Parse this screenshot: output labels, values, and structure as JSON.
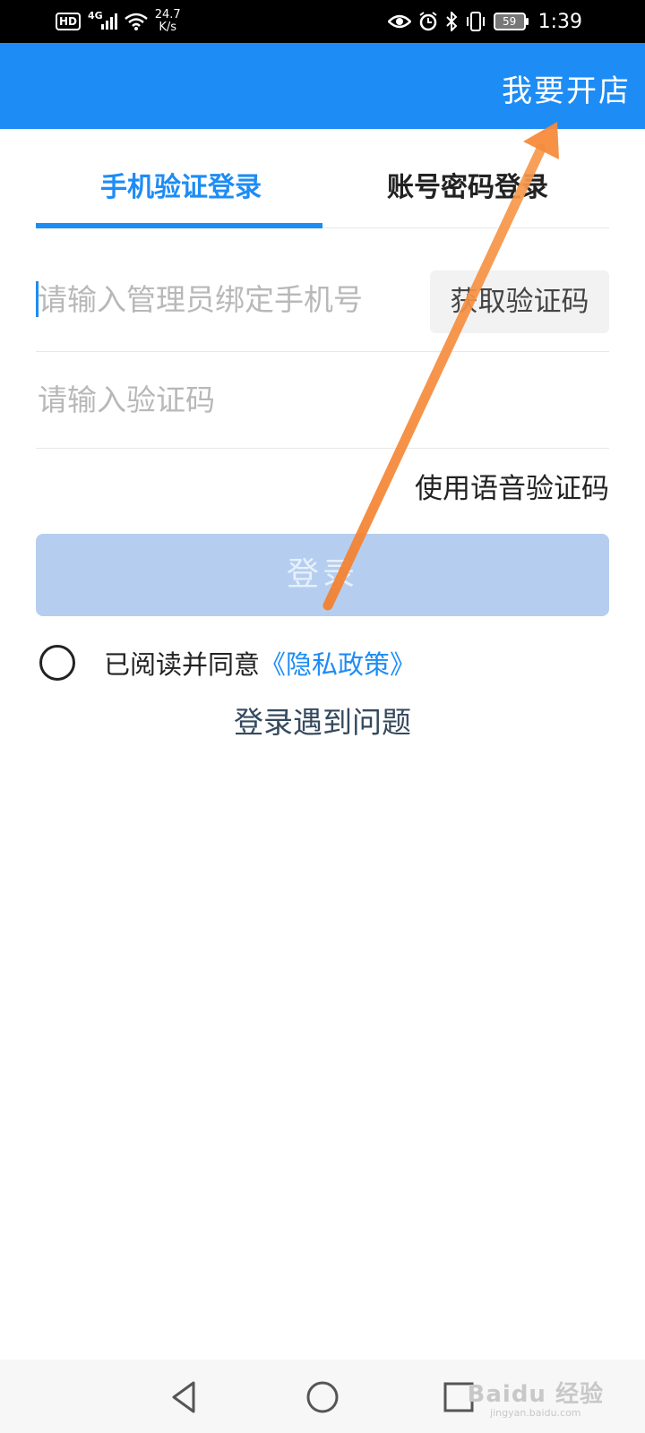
{
  "status_bar": {
    "hd": "HD",
    "network": "4G",
    "speed_value": "24.7",
    "speed_unit": "K/s",
    "battery": "59",
    "time": "1:39",
    "icons": [
      "signal-icon",
      "wifi-icon",
      "eye-icon",
      "alarm-icon",
      "bluetooth-icon",
      "vibrate-icon",
      "battery-icon"
    ]
  },
  "header": {
    "open_shop_label": "我要开店",
    "background_color": "#1e8cf5"
  },
  "tabs": [
    {
      "label": "手机验证登录",
      "active": true
    },
    {
      "label": "账号密码登录",
      "active": false
    }
  ],
  "form": {
    "phone_placeholder": "请输入管理员绑定手机号",
    "phone_value": "",
    "get_code_label": "获取验证码",
    "code_placeholder": "请输入验证码",
    "code_value": "",
    "voice_code_label": "使用语音验证码"
  },
  "login_button_label": "登录",
  "agreement": {
    "checked": false,
    "text": "已阅读并同意",
    "policy_link": "《隐私政策》"
  },
  "trouble_link": "登录遇到问题",
  "watermark": {
    "main": "Baidu 经验",
    "sub": "jingyan.baidu.com"
  },
  "annotation_arrow_color": "#f68b3c"
}
